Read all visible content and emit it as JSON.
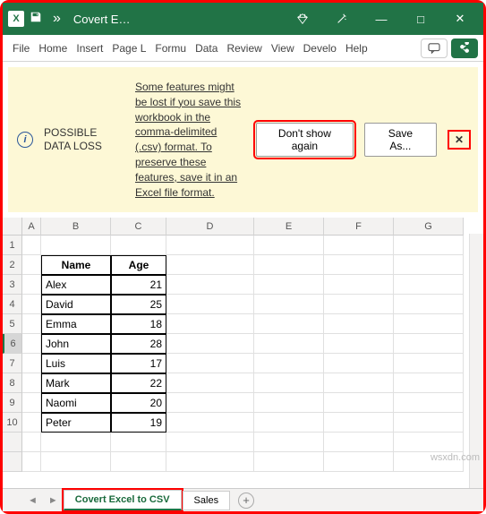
{
  "titlebar": {
    "app_icon_text": "X",
    "more": "»",
    "doc_name": "Covert E…",
    "window": {
      "min": "—",
      "max": "□",
      "close": "✕"
    }
  },
  "ribbon": {
    "tabs": [
      "File",
      "Home",
      "Insert",
      "Page L",
      "Formu",
      "Data",
      "Review",
      "View",
      "Develo",
      "Help"
    ]
  },
  "warning": {
    "title": "POSSIBLE DATA LOSS",
    "message": "Some features might be lost if you save this workbook in the comma-delimited (.csv) format. To preserve these features, save it in an Excel file format.",
    "btn_dont_show": "Don't show again",
    "btn_save_as": "Save As...",
    "close": "✕"
  },
  "columns": [
    "A",
    "B",
    "C",
    "D",
    "E",
    "F",
    "G"
  ],
  "rows": [
    "1",
    "2",
    "3",
    "4",
    "5",
    "6",
    "7",
    "8",
    "9",
    "10"
  ],
  "table": {
    "headers": [
      "Name",
      "Age"
    ],
    "data": [
      {
        "name": "Alex",
        "age": 21
      },
      {
        "name": "David",
        "age": 25
      },
      {
        "name": "Emma",
        "age": 18
      },
      {
        "name": "John",
        "age": 28
      },
      {
        "name": "Luis",
        "age": 17
      },
      {
        "name": "Mark",
        "age": 22
      },
      {
        "name": "Naomi",
        "age": 20
      },
      {
        "name": "Peter",
        "age": 19
      }
    ]
  },
  "sheet_tabs": {
    "active": "Covert Excel to CSV",
    "other": "Sales",
    "plus": "+"
  },
  "watermark": "wsxdn.com"
}
